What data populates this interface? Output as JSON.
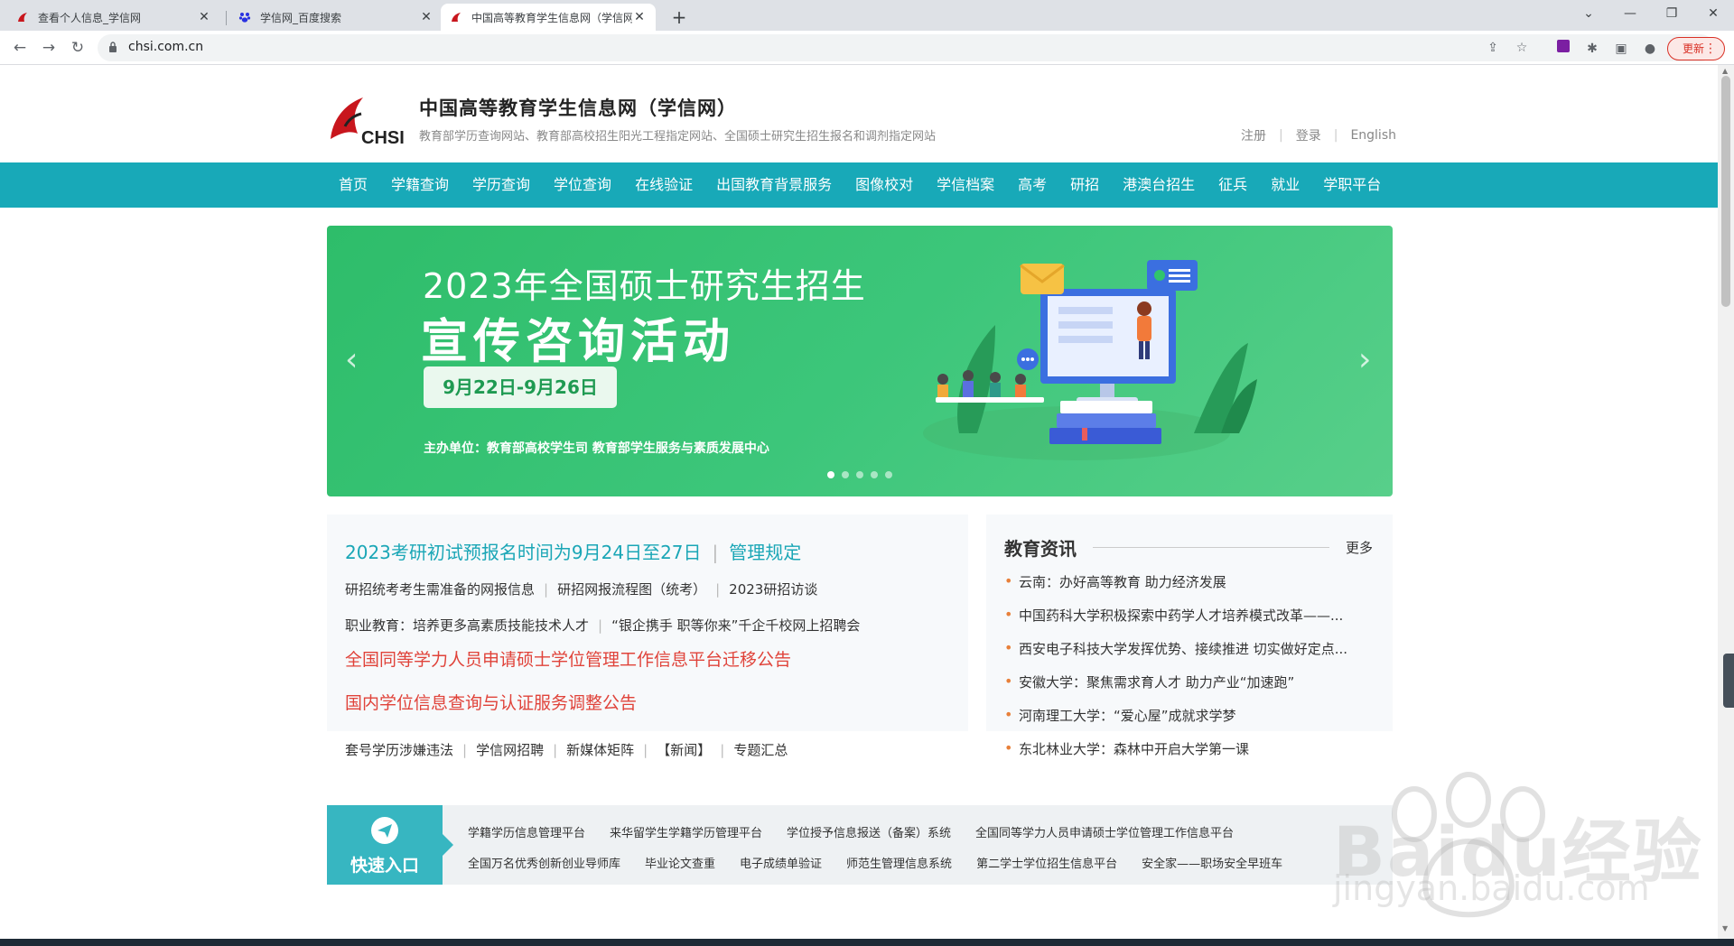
{
  "browser": {
    "tabs": [
      {
        "title": "查看个人信息_学信网",
        "active": false
      },
      {
        "title": "学信网_百度搜索",
        "active": false
      },
      {
        "title": "中国高等教育学生信息网（学信网",
        "active": true
      }
    ],
    "url": "chsi.com.cn",
    "update_label": "更新"
  },
  "header": {
    "logo_text": "CHSI",
    "site_name": "中国高等教育学生信息网（学信网）",
    "site_desc": "教育部学历查询网站、教育部高校招生阳光工程指定网站、全国硕士研究生招生报名和调剂指定网站",
    "links": [
      "注册",
      "登录",
      "English"
    ]
  },
  "nav": [
    "首页",
    "学籍查询",
    "学历查询",
    "学位查询",
    "在线验证",
    "出国教育背景服务",
    "图像校对",
    "学信档案",
    "高考",
    "研招",
    "港澳台招生",
    "征兵",
    "就业",
    "学职平台"
  ],
  "banner": {
    "line1": "2023年全国硕士研究生招生",
    "line2": "宣传咨询活动",
    "date": "9月22日-9月26日",
    "host": "主办单位：教育部高校学生司  教育部学生服务与素质发展中心",
    "slide_count": 5,
    "active_slide": 0,
    "colors": {
      "start": "#2ebd6a",
      "end": "#58cf8a"
    }
  },
  "news_left": {
    "headline": "2023考研初试预报名时间为9月24日至27日",
    "headline_link": "管理规定",
    "row1": [
      "研招统考考生需准备的网报信息",
      "研招网报流程图（统考）",
      "2023研招访谈"
    ],
    "row2": [
      "职业教育：培养更多高素质技能技术人才",
      "“银企携手 职等你来”千企千校网上招聘会"
    ],
    "red1": "全国同等学力人员申请硕士学位管理工作信息平台迁移公告",
    "red2": "国内学位信息查询与认证服务调整公告",
    "row3": [
      "套号学历涉嫌违法",
      "学信网招聘",
      "新媒体矩阵",
      "【新闻】",
      "专题汇总"
    ]
  },
  "news_right": {
    "title": "教育资讯",
    "more": "更多",
    "items": [
      "云南：办好高等教育 助力经济发展",
      "中国药科大学积极探索中药学人才培养模式改革——...",
      "西安电子科技大学发挥优势、接续推进 切实做好定点...",
      "安徽大学：聚焦需求育人才 助力产业“加速跑”",
      "河南理工大学：“爱心屋”成就求学梦",
      "东北林业大学：森林中开启大学第一课"
    ]
  },
  "quick": {
    "label": "快速入口",
    "row1": [
      "学籍学历信息管理平台",
      "来华留学生学籍学历管理平台",
      "学位授予信息报送（备案）系统",
      "全国同等学力人员申请硕士学位管理工作信息平台"
    ],
    "row2": [
      "全国万名优秀创新创业导师库",
      "毕业论文查重",
      "电子成绩单验证",
      "师范生管理信息系统",
      "第二学士学位招生信息平台",
      "安全家——职场安全早班车"
    ]
  },
  "watermark": {
    "text": "Baidu经验",
    "sub": "jingyan.baidu.com"
  },
  "colors": {
    "nav_bg": "#18a9b8",
    "accent": "#1aa6b6",
    "alert_red": "#e0433a",
    "bullet": "#e8803a"
  }
}
